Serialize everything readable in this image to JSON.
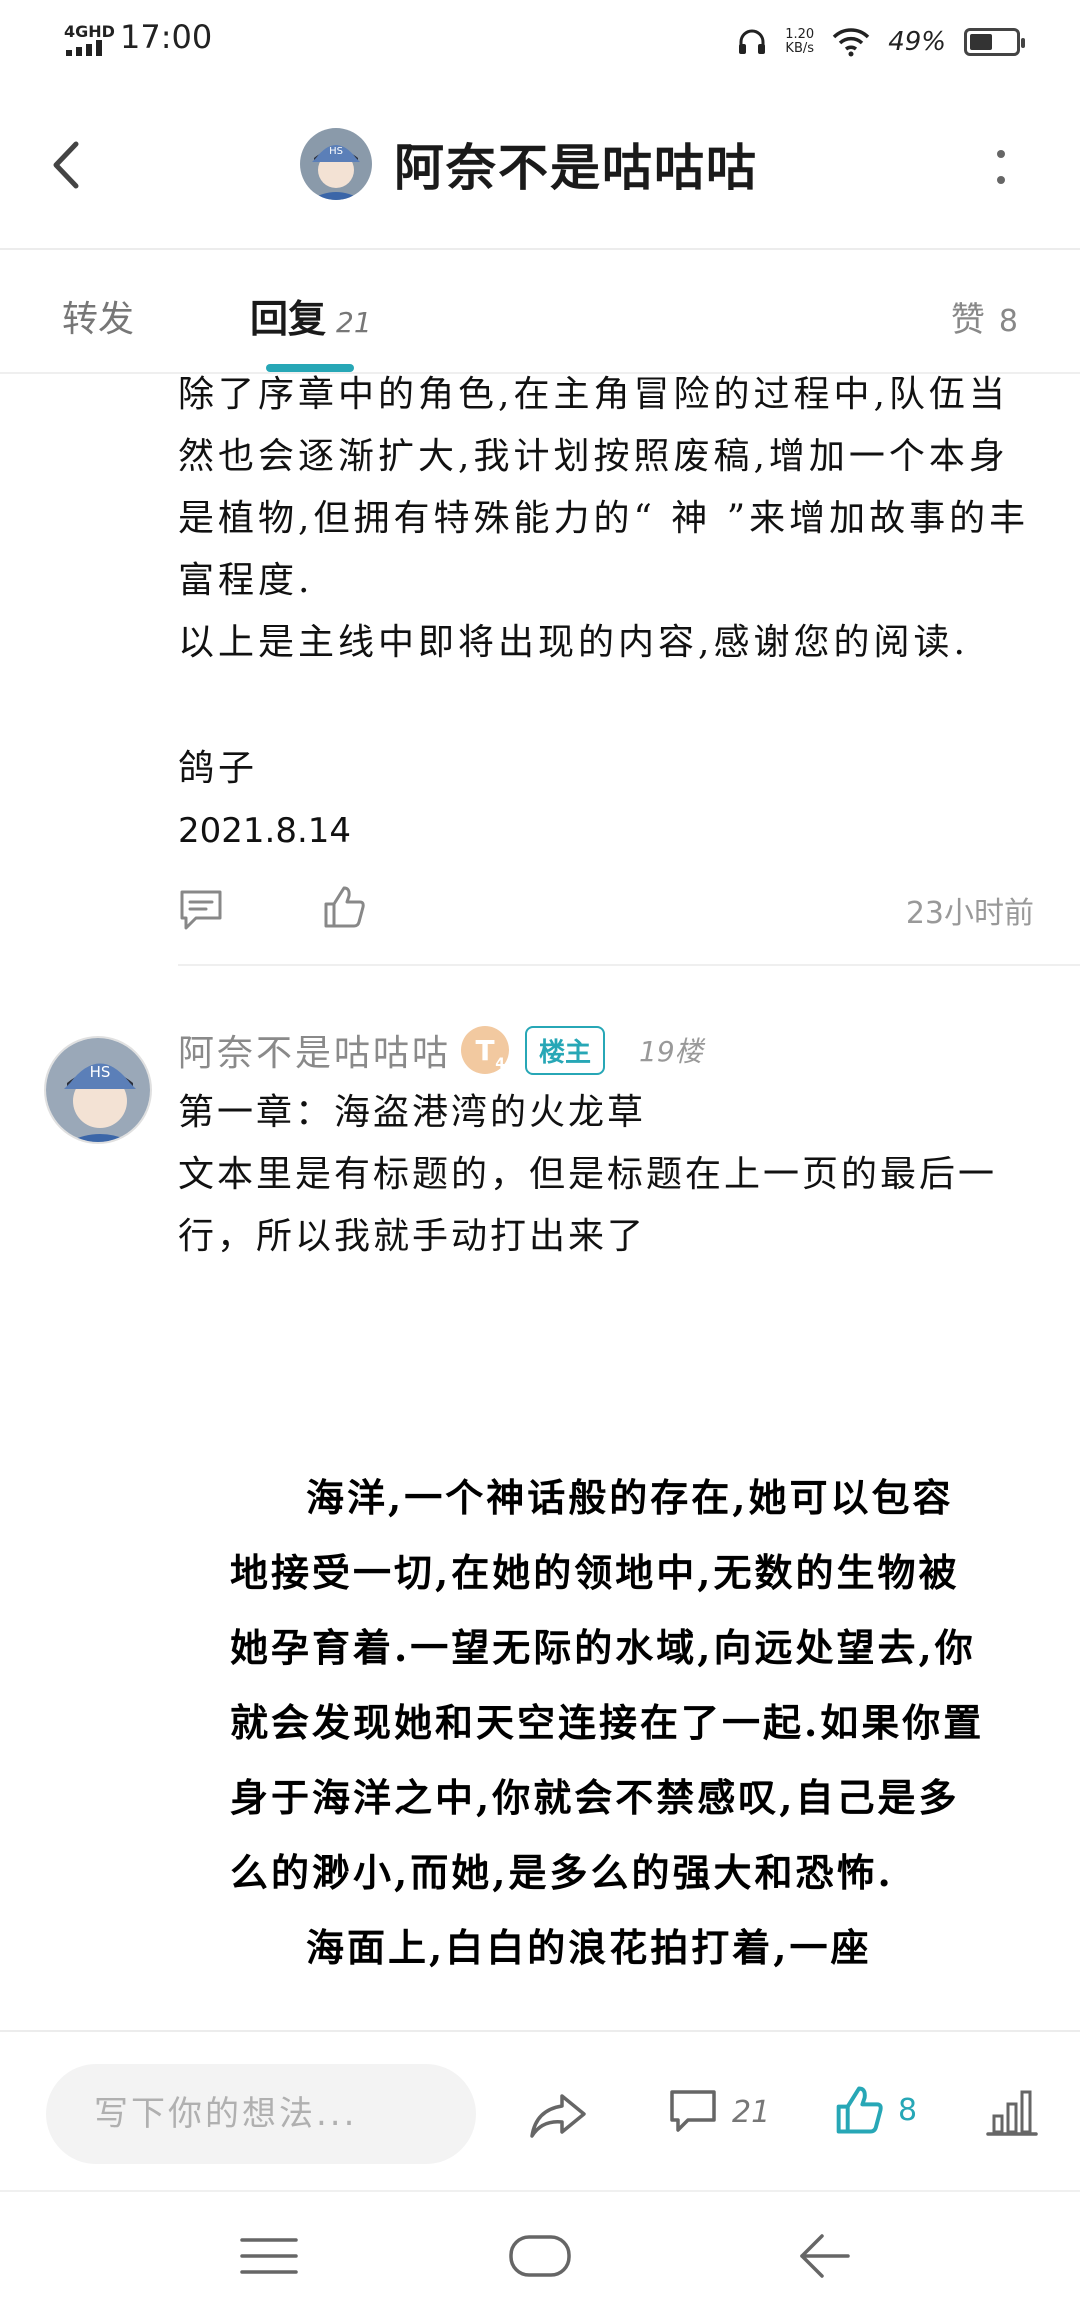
{
  "status_bar": {
    "network": "4GHD",
    "time": "17:00",
    "speed_value": "1.20",
    "speed_unit": "KB/s",
    "battery": "49%",
    "battery_level": 0.49
  },
  "header": {
    "title": "阿奈不是咕咕咕"
  },
  "tabs": {
    "forward": "转发",
    "reply": "回复",
    "reply_count": "21",
    "likes": "赞",
    "likes_count": "8"
  },
  "post": {
    "paragraphs": [
      "除了序章中的角色,在主角冒险的过程中,队伍当然也会逐渐扩大,我计划按照废稿,增加一个本身是植物,但拥有特殊能力的“ 神 ”来增加故事的丰富程度.",
      "以上是主线中即将出现的内容,感谢您的阅读."
    ],
    "signature": "鸽子",
    "date": "2021.8.14",
    "time_ago": "23小时前"
  },
  "reply": {
    "author": "阿奈不是咕咕咕",
    "level_letter": "T",
    "level_number": "4",
    "op_badge": "楼主",
    "floor": "19楼",
    "lines": [
      "第一章：海盗港湾的火龙草",
      "文本里是有标题的，但是标题在上一页的最后一行，所以我就手动打出来了"
    ],
    "image_text": [
      "海洋,一个神话般的存在,她可以包容地接受一切,在她的领地中,无数的生物被她孕育着.一望无际的水域,向远处望去,你就会发现她和天空连接在了一起.如果你置身于海洋之中,你就会不禁感叹,自己是多么的渺小,而她,是多么的强大和恐怖.",
      "海面上,白白的浪花拍打着,一座"
    ]
  },
  "bottom_bar": {
    "input_placeholder": "写下你的想法...",
    "comment_count": "21",
    "like_count": "8"
  },
  "colors": {
    "accent": "#27a7b6",
    "level_badge": "#f2c9a0"
  },
  "icons": [
    "back-arrow-icon",
    "more-vertical-icon",
    "comment-icon",
    "thumbs-up-icon",
    "share-icon",
    "bar-chart-icon",
    "menu-icon",
    "home-icon",
    "nav-back-icon",
    "wifi-icon",
    "headphones-icon"
  ]
}
